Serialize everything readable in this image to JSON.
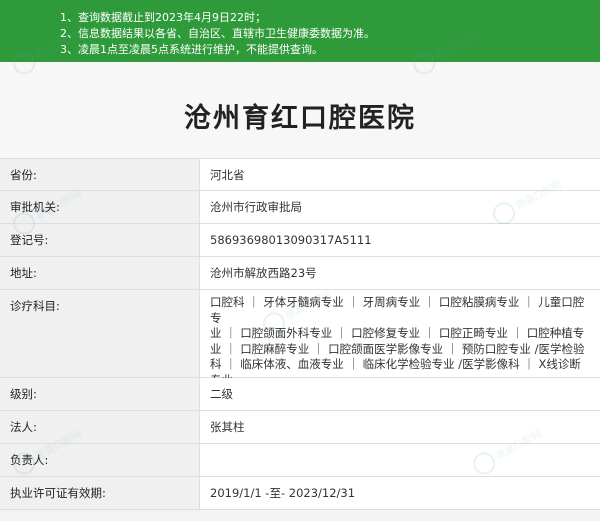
{
  "notice": {
    "lines": [
      "1、查询数据截止到2023年4月9日22时；",
      "2、信息数据结果以各省、自治区、直辖市卫生健康委数据为准。",
      "3、凌晨1点至凌晨5点系统进行维护，不能提供查询。"
    ]
  },
  "page_title": "沧州育红口腔医院",
  "rows": [
    {
      "label": "省份:",
      "value": "河北省"
    },
    {
      "label": "审批机关:",
      "value": "沧州市行政审批局"
    },
    {
      "label": "登记号:",
      "value": "58693698013090317A5111"
    },
    {
      "label": "地址:",
      "value": "沧州市解放西路23号"
    },
    {
      "label": "诊疗科目:",
      "value_lines": [
        "口腔科 ｜ 牙体牙髓病专业 ｜ 牙周病专业 ｜ 口腔粘膜病专业 ｜ 儿童口腔专",
        "业 ｜ 口腔颌面外科专业 ｜ 口腔修复专业 ｜ 口腔正畸专业 ｜ 口腔种植专",
        "业 ｜ 口腔麻醉专业 ｜ 口腔颌面医学影像专业 ｜ 预防口腔专业 /医学检验",
        "科 ｜ 临床体液、血液专业 ｜ 临床化学检验专业 /医学影像科 ｜ X线诊断专业",
        "******"
      ]
    },
    {
      "label": "级别:",
      "value": "二级"
    },
    {
      "label": "法人:",
      "value": "张其柱"
    },
    {
      "label": "负责人:",
      "value": ""
    },
    {
      "label": "执业许可证有效期:",
      "value": "2019/1/1 -至- 2023/12/31"
    }
  ],
  "watermark_text": "德嘉口腔网"
}
